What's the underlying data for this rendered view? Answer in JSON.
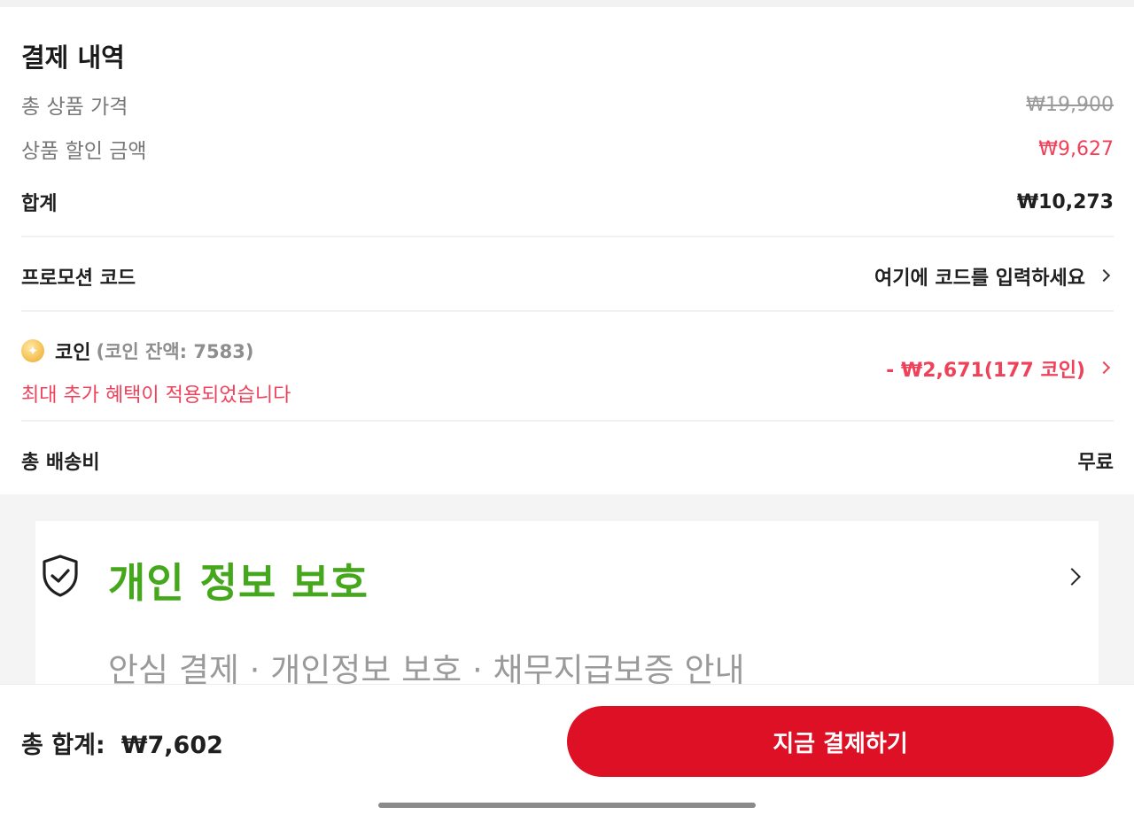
{
  "payment_summary": {
    "title": "결제 내역",
    "total_product_price_label": "총 상품 가격",
    "total_product_price_value": "₩19,900",
    "product_discount_label": "상품 할인 금액",
    "product_discount_value": "₩9,627",
    "subtotal_label": "합계",
    "subtotal_value": "₩10,273",
    "promo_label": "프로모션 코드",
    "promo_placeholder": "여기에 코드를 입력하세요",
    "coin_label": "코인",
    "coin_balance": "(코인 잔액: 7583)",
    "coin_benefit": "최대 추가 혜택이 적용되었습니다",
    "coin_value": "- ₩2,671(177 코인)",
    "shipping_label": "총 배송비",
    "shipping_value": "무료"
  },
  "privacy": {
    "title": "개인 정보 보호",
    "subtitle": "안심 결제 · 개인정보 보호 · 채무지급보증 안내"
  },
  "checkout": {
    "total_label": "총 합계:",
    "total_value": "₩7,602",
    "pay_button_label": "지금 결제하기"
  },
  "colors": {
    "accent_red": "#dd1025",
    "discount_red": "#f0415a",
    "privacy_green": "#45a81c"
  },
  "icons": {
    "coin": "coin-icon",
    "shield": "shield-check-icon",
    "chevron": "chevron-right-icon"
  }
}
